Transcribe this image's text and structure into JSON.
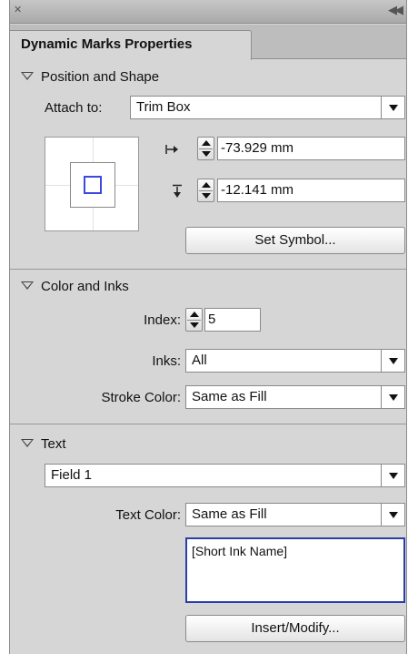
{
  "window": {
    "title_tab": "Dynamic Marks Properties"
  },
  "sections": {
    "position": {
      "header": "Position and Shape",
      "attach_label": "Attach to:",
      "attach_value": "Trim Box",
      "x_value": "-73.929 mm",
      "y_value": "-12.141 mm",
      "set_symbol_button": "Set Symbol..."
    },
    "color": {
      "header": "Color and Inks",
      "index_label": "Index:",
      "index_value": "5",
      "inks_label": "Inks:",
      "inks_value": "All",
      "stroke_label": "Stroke Color:",
      "stroke_value": "Same as Fill"
    },
    "text": {
      "header": "Text",
      "field_value": "Field 1",
      "text_color_label": "Text Color:",
      "text_color_value": "Same as Fill",
      "text_content": "[Short Ink Name]",
      "insert_button": "Insert/Modify..."
    }
  },
  "icons": {
    "close": "close-icon",
    "collapse": "collapse-arrows-icon",
    "expand": "disclosure-triangle-icon",
    "dropdown": "chevron-down-icon",
    "stepper": "stepper-icon"
  },
  "colors": {
    "panel_bg": "#d6d6d6",
    "mark_blue": "#3b49e0",
    "focus_blue": "#2b3ea8"
  }
}
